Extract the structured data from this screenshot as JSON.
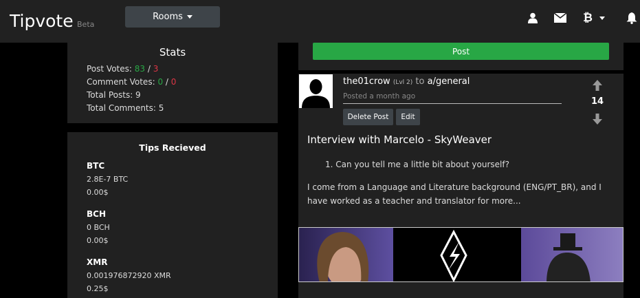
{
  "navbar": {
    "brand": "Tipvote",
    "beta": "Beta",
    "rooms_label": "Rooms",
    "icons": [
      "user-icon",
      "envelope-icon",
      "bitcoin-icon",
      "bell-icon"
    ]
  },
  "stats": {
    "title": "Stats",
    "post_votes_label": "Post Votes:",
    "post_votes_up": "83",
    "post_votes_down": "3",
    "comment_votes_label": "Comment Votes:",
    "comment_votes_up": "0",
    "comment_votes_down": "0",
    "total_posts": "Total Posts: 9",
    "total_comments": "Total Comments: 5",
    "sep": "/"
  },
  "tips": {
    "title": "Tips Recieved",
    "coins": [
      {
        "name": "BTC",
        "amount": "2.8E-7 BTC",
        "usd": "0.00$"
      },
      {
        "name": "BCH",
        "amount": "0 BCH",
        "usd": "0.00$"
      },
      {
        "name": "XMR",
        "amount": "0.001976872920 XMR",
        "usd": "0.25$"
      }
    ]
  },
  "post_button": "Post",
  "post": {
    "author": "the01crow",
    "level": "(Lvl 2)",
    "to": "to",
    "room": "a/general",
    "posted": "Posted a month ago",
    "delete_label": "Delete Post",
    "edit_label": "Edit",
    "votes": "14",
    "title": "Interview with Marcelo - SkyWeaver",
    "list_item": "1. Can you tell me a little bit about yourself?",
    "body": "I come from a Language and Literature background (ENG/PT_BR), and I have worked as a teacher and translator for more..."
  },
  "colors": {
    "accent_green": "#28a745",
    "down_red": "#dc3545",
    "panel": "#212121"
  }
}
